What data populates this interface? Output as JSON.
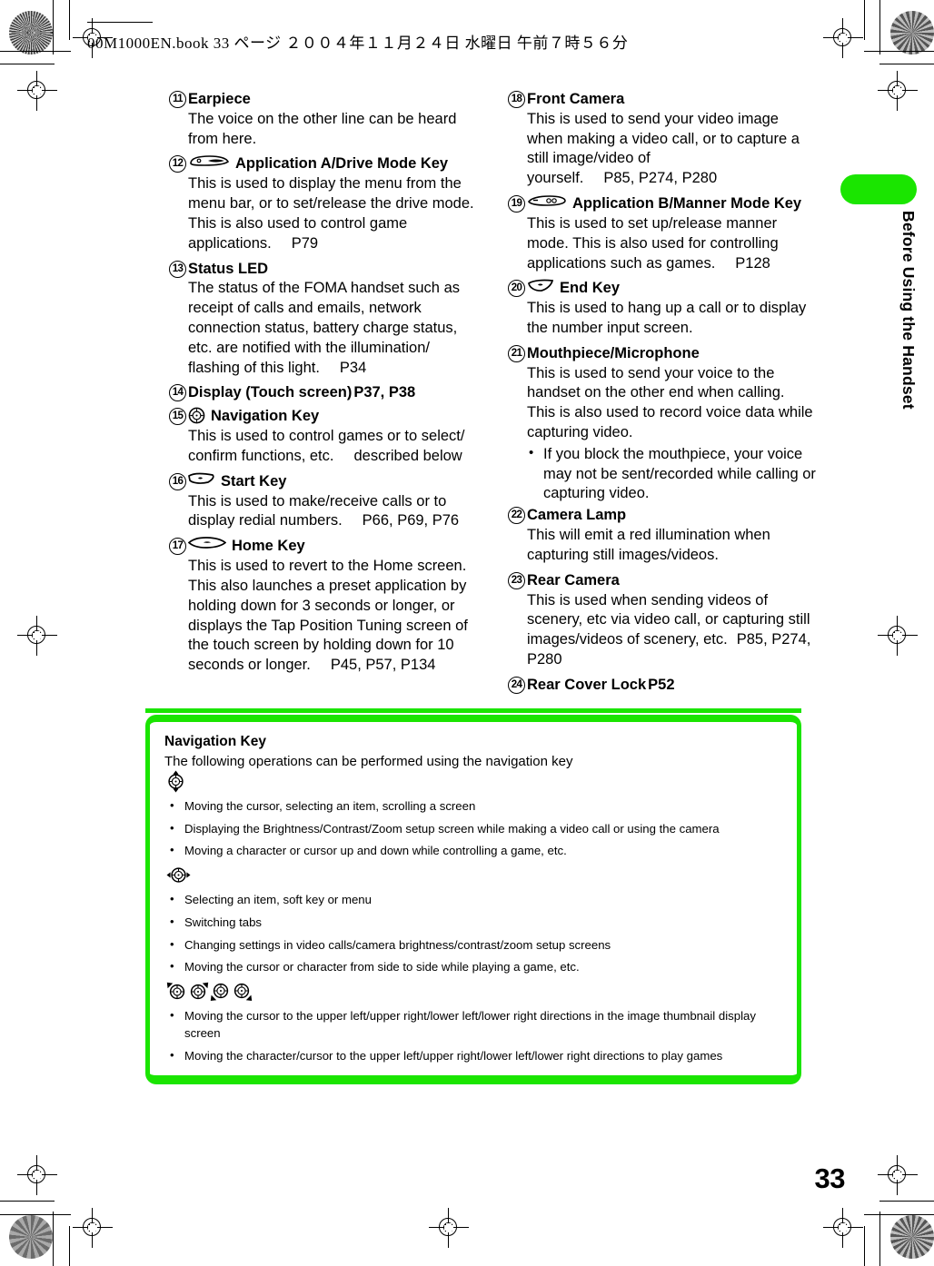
{
  "header": {
    "filename_line": "00M1000EN.book    33 ページ    ２００４年１１月２４日   水曜日   午前７時５６分"
  },
  "side_tab": {
    "label": "Before Using the Handset",
    "accent_color": "#1ae500"
  },
  "page_number": "33",
  "columns": {
    "left": [
      {
        "num": "11",
        "icon": "",
        "title": "Earpiece",
        "title_ref": "",
        "body": "The voice on the other line can be heard from here.",
        "body_ref": ""
      },
      {
        "num": "12",
        "icon": "application-a-key-icon",
        "title": "Application A/Drive Mode Key",
        "title_ref": "",
        "body": "This is used to display the menu from the menu bar, or to set/release the drive mode. This is also used to control game applications.",
        "body_ref": "P79"
      },
      {
        "num": "13",
        "icon": "",
        "title": "Status LED",
        "title_ref": "",
        "body": "The status of the FOMA handset such as receipt of calls and emails, network connection status, battery charge status, etc. are notified with the illumination/ flashing of this light.",
        "body_ref": "P34"
      },
      {
        "num": "14",
        "icon": "",
        "title": "Display (Touch screen)",
        "title_ref": "P37, P38",
        "body": "",
        "body_ref": ""
      },
      {
        "num": "15",
        "icon": "navigation-key-icon",
        "title": "Navigation Key",
        "title_ref": "",
        "body": "This is used to control games or to select/ confirm functions, etc.",
        "body_ref": "described below"
      },
      {
        "num": "16",
        "icon": "start-key-icon",
        "title": "Start Key",
        "title_ref": "",
        "body": "This is used to make/receive calls or to display redial numbers.",
        "body_ref": "P66, P69, P76"
      },
      {
        "num": "17",
        "icon": "home-key-icon",
        "title": "Home Key",
        "title_ref": "",
        "body": "This is used to revert to the Home screen. This also launches a preset application by holding down for 3 seconds or longer, or displays the Tap Position Tuning screen of the touch screen by holding down for 10 seconds or longer.",
        "body_ref": "P45, P57, P134"
      }
    ],
    "right": [
      {
        "num": "18",
        "icon": "",
        "title": "Front Camera",
        "title_ref": "",
        "body": "This is used to send your video image when making a video call, or to capture a still image/video of yourself.",
        "body_ref": "P85, P274, P280"
      },
      {
        "num": "19",
        "icon": "application-b-key-icon",
        "title": "Application B/Manner Mode Key",
        "title_ref": "",
        "body": "This is used to set up/release manner mode. This is also used for controlling applications such as games.",
        "body_ref": "P128"
      },
      {
        "num": "20",
        "icon": "end-key-icon",
        "title": "End Key",
        "title_ref": "",
        "body": "This is used to hang up a call or to display the number input screen.",
        "body_ref": ""
      },
      {
        "num": "21",
        "icon": "",
        "title": "Mouthpiece/Microphone",
        "title_ref": "",
        "body": "This is used to send your voice to the handset on the other end when calling. This is also used to record voice data while capturing video.",
        "body_ref": "",
        "sub_bullets": [
          "If you block the mouthpiece, your voice may not be sent/recorded while calling or capturing video."
        ]
      },
      {
        "num": "22",
        "icon": "",
        "title": "Camera Lamp",
        "title_ref": "",
        "body": "This will emit a red illumination when capturing still images/videos.",
        "body_ref": ""
      },
      {
        "num": "23",
        "icon": "",
        "title": "Rear Camera",
        "title_ref": "",
        "body": "This is used when sending videos of scenery, etc via video call, or capturing still images/videos of scenery, etc.",
        "body_ref": "P85, P274, P280"
      },
      {
        "num": "24",
        "icon": "",
        "title": "Rear Cover Lock",
        "title_ref": "P52",
        "body": "",
        "body_ref": ""
      }
    ]
  },
  "nav_box": {
    "title": "Navigation Key",
    "intro": "The following operations can be performed using the navigation key",
    "group1_icon": "nav-key-up-down-icon",
    "group1": [
      "Moving the cursor, selecting an item, scrolling a screen",
      "Displaying the Brightness/Contrast/Zoom setup screen while making a video call or using the camera",
      "Moving a character or cursor up and down while controlling a game, etc."
    ],
    "group2_icon": "nav-key-left-right-icon",
    "group2": [
      "Selecting an item, soft key or menu",
      "Switching tabs",
      "Changing settings in video calls/camera brightness/contrast/zoom setup screens",
      "Moving the cursor or character from side to side while playing a game, etc."
    ],
    "group3_icons": [
      "nav-key-upper-left-icon",
      "nav-key-upper-right-icon",
      "nav-key-lower-left-icon",
      "nav-key-lower-right-icon"
    ],
    "group3": [
      "Moving the cursor to the upper left/upper right/lower left/lower right directions in the image thumbnail display screen",
      "Moving the character/cursor to the upper left/upper right/lower left/lower right directions to play games"
    ]
  }
}
